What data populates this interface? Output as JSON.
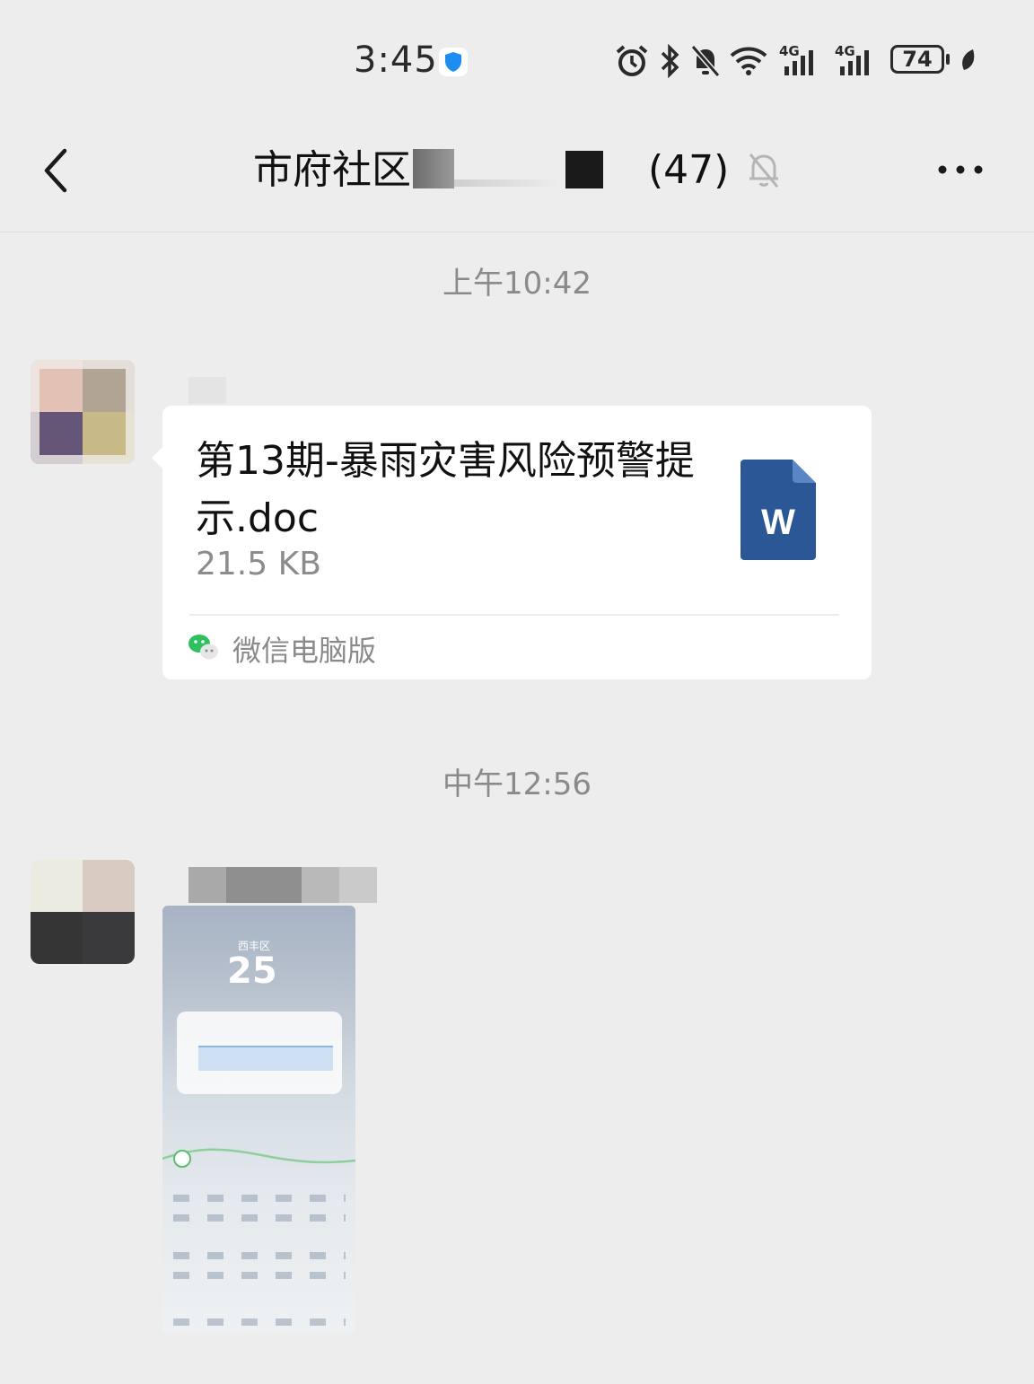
{
  "status_bar": {
    "time": "3:45",
    "battery": "74",
    "network_1": "4G",
    "network_2": "4G"
  },
  "header": {
    "title": "市府社区",
    "member_count": "(47)"
  },
  "messages": [
    {
      "type": "file",
      "timestamp": "上午10:42",
      "file_name": "第13期-暴雨灾害风险预警提示.doc",
      "file_size": "21.5 KB",
      "file_icon": "word-doc-icon",
      "file_icon_letter": "W",
      "source": "微信电脑版"
    },
    {
      "type": "image",
      "timestamp": "中午12:56",
      "thumbnail": {
        "city": "西丰区",
        "temperature": "25"
      }
    }
  ],
  "colors": {
    "background": "#ededed",
    "bubble": "#ffffff",
    "word_blue": "#2b5797",
    "wechat_green": "#2ec15d",
    "timestamp_gray": "#8a8a8a"
  }
}
